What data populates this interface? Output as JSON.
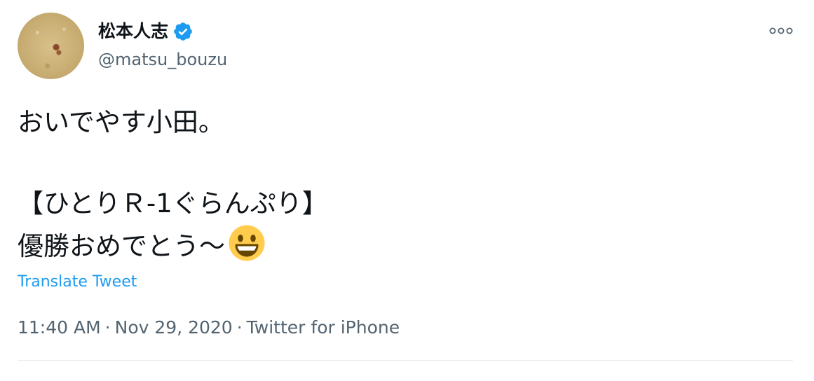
{
  "author": {
    "display_name": "松本人志",
    "handle": "@matsu_bouzu",
    "verified_icon": "verified-badge-icon",
    "verified_color": "#1d9bf0"
  },
  "more_icon": "more-options-icon",
  "tweet": {
    "lines": [
      "おいでやす小田。",
      "",
      "【ひとりＲ-1ぐらんぷり】",
      "優勝おめでとう〜"
    ],
    "emoji": "smiling-face-open-mouth-emoji"
  },
  "translate_label": "Translate Tweet",
  "meta": {
    "time": "11:40 AM",
    "date": "Nov 29, 2020",
    "source": "Twitter for iPhone",
    "separator": "·"
  },
  "colors": {
    "link": "#1d9bf0",
    "secondary_text": "#536471",
    "primary_text": "#0f1419"
  }
}
